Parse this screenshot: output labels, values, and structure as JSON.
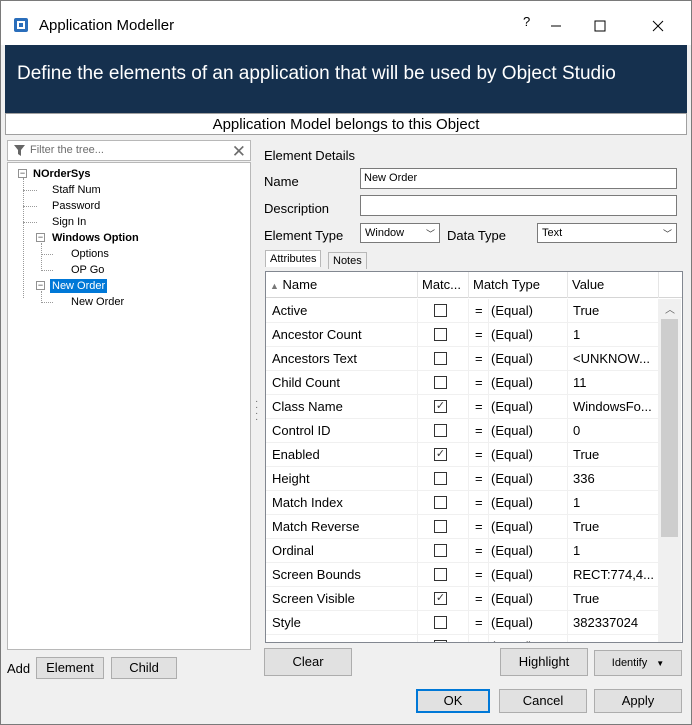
{
  "window": {
    "title": "Application Modeller",
    "help": "?"
  },
  "banner": {
    "text": "Define the elements of an application that will be used by Object Studio"
  },
  "owner_bar": {
    "text": "Application Model belongs to this Object"
  },
  "filter": {
    "placeholder": "Filter the tree..."
  },
  "tree": {
    "root": "NOrderSys",
    "items": [
      "Staff Num",
      "Password",
      "Sign In"
    ],
    "windows_option": {
      "label": "Windows Option",
      "children": [
        "Options",
        "OP Go"
      ]
    },
    "new_order": {
      "label": "New Order",
      "children": [
        "New Order"
      ]
    }
  },
  "details": {
    "heading": "Element Details",
    "name_label": "Name",
    "name_value": "New Order",
    "description_label": "Description",
    "description_value": "",
    "element_type_label": "Element Type",
    "element_type_value": "Window",
    "data_type_label": "Data Type",
    "data_type_value": "Text"
  },
  "tabs": [
    "Attributes",
    "Notes"
  ],
  "grid": {
    "columns": [
      "Name",
      "Matc...",
      "Match Type",
      "Value"
    ],
    "rows": [
      {
        "name": "Active",
        "match": false,
        "eq": "=",
        "type": "(Equal)",
        "value": "True"
      },
      {
        "name": "Ancestor Count",
        "match": false,
        "eq": "=",
        "type": "(Equal)",
        "value": "1"
      },
      {
        "name": "Ancestors Text",
        "match": false,
        "eq": "=",
        "type": "(Equal)",
        "value": "<UNKNOW..."
      },
      {
        "name": "Child Count",
        "match": false,
        "eq": "=",
        "type": "(Equal)",
        "value": "11"
      },
      {
        "name": "Class Name",
        "match": true,
        "eq": "=",
        "type": "(Equal)",
        "value": "WindowsFo..."
      },
      {
        "name": "Control ID",
        "match": false,
        "eq": "=",
        "type": "(Equal)",
        "value": "0"
      },
      {
        "name": "Enabled",
        "match": true,
        "eq": "=",
        "type": "(Equal)",
        "value": "True"
      },
      {
        "name": "Height",
        "match": false,
        "eq": "=",
        "type": "(Equal)",
        "value": "336"
      },
      {
        "name": "Match Index",
        "match": false,
        "eq": "=",
        "type": "(Equal)",
        "value": "1"
      },
      {
        "name": "Match Reverse",
        "match": false,
        "eq": "=",
        "type": "(Equal)",
        "value": "True"
      },
      {
        "name": "Ordinal",
        "match": false,
        "eq": "=",
        "type": "(Equal)",
        "value": "1"
      },
      {
        "name": "Screen Bounds",
        "match": false,
        "eq": "=",
        "type": "(Equal)",
        "value": "RECT:774,4..."
      },
      {
        "name": "Screen Visible",
        "match": true,
        "eq": "=",
        "type": "(Equal)",
        "value": "True"
      },
      {
        "name": "Style",
        "match": false,
        "eq": "=",
        "type": "(Equal)",
        "value": "382337024"
      },
      {
        "name": "Text Ne...",
        "match": false,
        "eq": "=",
        "type": "(Equal)",
        "value": ""
      }
    ]
  },
  "bottom": {
    "add_label": "Add",
    "element_button": "Element",
    "child_button": "Child",
    "clear_button": "Clear",
    "highlight_button": "Highlight",
    "identify_button": "Identify",
    "ok_button": "OK",
    "cancel_button": "Cancel",
    "apply_button": "Apply"
  }
}
